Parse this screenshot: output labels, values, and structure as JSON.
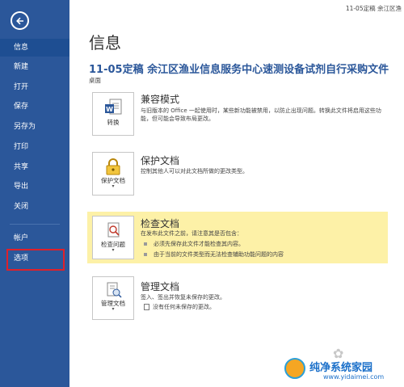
{
  "window": {
    "title": "11-05定稿 余江区渔"
  },
  "sidebar": {
    "items": [
      {
        "label": "信息"
      },
      {
        "label": "新建"
      },
      {
        "label": "打开"
      },
      {
        "label": "保存"
      },
      {
        "label": "另存为"
      },
      {
        "label": "打印"
      },
      {
        "label": "共享"
      },
      {
        "label": "导出"
      },
      {
        "label": "关闭"
      },
      {
        "label": "帐户"
      },
      {
        "label": "选项"
      }
    ],
    "selected": "信息",
    "colors": {
      "background": "#2b579a",
      "highlight_box": "#e0202a"
    }
  },
  "main": {
    "page_title": "信息",
    "doc_name": "11-05定稿 余江区渔业信息服务中心速测设备试剂自行采购文件",
    "doc_location": "桌面",
    "sections": [
      {
        "title": "兼容模式",
        "button_label": "转换",
        "description": "与旧版本的 Office 一起使用时，某些新功能被禁用，以防止出现问题。转换此文件将启用这些功能，但可能会导致布局更改。",
        "icon": "word-convert-icon"
      },
      {
        "title": "保护文档",
        "button_label": "保护文档",
        "description": "控制其他人可以对此文档所做的更改类型。",
        "icon": "lock-key-icon"
      },
      {
        "title": "检查文档",
        "button_label": "检查问题",
        "description": "在发布此文件之前，请注意其是否包含：",
        "bullets": [
          "必须先保存此文件才能检查其内容。",
          "由于当前的文件类型而无法检查辅助功能问题的内容"
        ],
        "icon": "inspect-document-icon",
        "highlight_color": "#fdf1a7"
      },
      {
        "title": "管理文档",
        "button_label": "管理文档",
        "description": "签入、签出并恢复未保存的更改。",
        "bullets": [
          "没有任何未保存的更改。"
        ],
        "icon": "manage-document-icon"
      }
    ]
  },
  "watermark": {
    "text": "纯净系统家园",
    "url": "www.yidaimei.com"
  }
}
